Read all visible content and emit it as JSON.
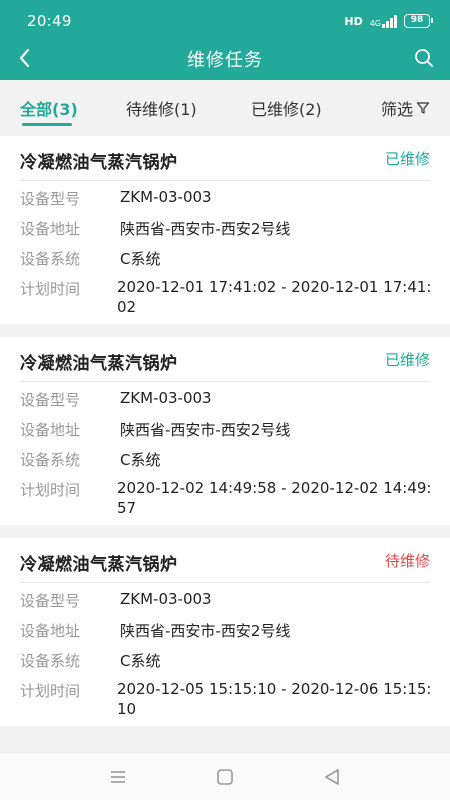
{
  "status_bar": {
    "time": "20:49",
    "hd": "HD",
    "network": "4G",
    "battery": "98"
  },
  "app_bar": {
    "title": "维修任务",
    "back_icon": "chevron-left-icon",
    "search_icon": "search-icon"
  },
  "tabs": [
    {
      "label": "全部(3)",
      "active": true
    },
    {
      "label": "待维修(1)",
      "active": false
    },
    {
      "label": "已维修(2)",
      "active": false
    }
  ],
  "filter": {
    "label": "筛选",
    "icon": "filter-icon"
  },
  "field_labels": {
    "model": "设备型号",
    "address": "设备地址",
    "system": "设备系统",
    "plan_time": "计划时间"
  },
  "tasks": [
    {
      "name": "冷凝燃油气蒸汽锅炉",
      "status": "已维修",
      "model": "ZKM-03-003",
      "address": "陕西省-西安市-西安2号线",
      "system": "C系统",
      "plan_time": "2020-12-01 17:41:02 - 2020-12-01 17:41:02"
    },
    {
      "name": "冷凝燃油气蒸汽锅炉",
      "status": "已维修",
      "model": "ZKM-03-003",
      "address": "陕西省-西安市-西安2号线",
      "system": "C系统",
      "plan_time": "2020-12-02 14:49:58 - 2020-12-02 14:49:57"
    },
    {
      "name": "冷凝燃油气蒸汽锅炉",
      "status": "待维修",
      "model": "ZKM-03-003",
      "address": "陕西省-西安市-西安2号线",
      "system": "C系统",
      "plan_time": "2020-12-05 15:15:10 - 2020-12-06 15:15:10"
    }
  ],
  "colors": {
    "primary": "#23a99a",
    "status_done": "#23a99a",
    "status_pending": "#e0484e",
    "label_gray": "#999999"
  },
  "nav_bar": {
    "icons": [
      "menu-icon",
      "home-icon",
      "back-triangle-icon"
    ]
  }
}
